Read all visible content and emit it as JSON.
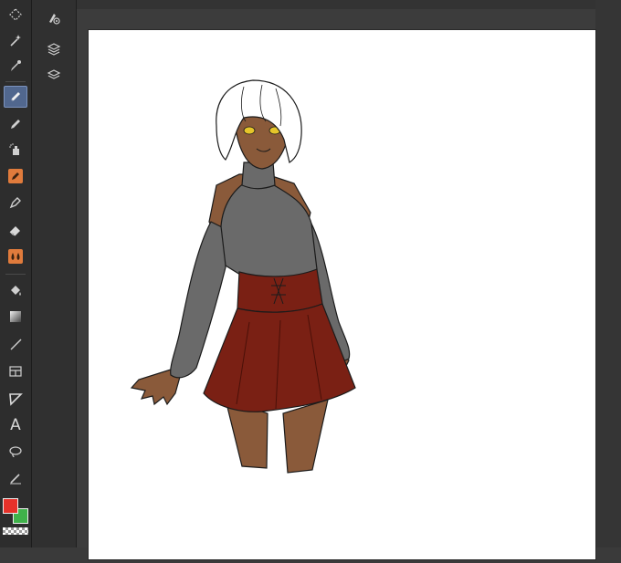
{
  "toolbar": {
    "tools": [
      {
        "name": "marquee-select-tool",
        "icon": "dotted-select-icon",
        "active": false
      },
      {
        "name": "magic-wand-tool",
        "icon": "magic-wand-icon",
        "active": false
      },
      {
        "name": "eyedropper-tool",
        "icon": "eyedropper-icon",
        "active": false
      },
      {
        "name": "pen-tool",
        "icon": "pen-icon",
        "active": true
      },
      {
        "name": "pencil-tool",
        "icon": "pencil-icon",
        "active": false
      },
      {
        "name": "airbrush-tool",
        "icon": "airbrush-icon",
        "active": false
      },
      {
        "name": "decoration-tool",
        "icon": "decoration-icon",
        "active": false
      },
      {
        "name": "ink-pen-tool",
        "icon": "ink-pen-icon",
        "active": false
      },
      {
        "name": "eraser-tool",
        "icon": "eraser-icon",
        "active": false
      },
      {
        "name": "blend-tool",
        "icon": "blend-drops-icon",
        "active": false
      },
      {
        "name": "fill-tool",
        "icon": "fill-bucket-icon",
        "active": false
      },
      {
        "name": "gradient-tool",
        "icon": "gradient-icon",
        "active": false
      },
      {
        "name": "line-tool",
        "icon": "line-icon",
        "active": false
      },
      {
        "name": "frame-tool",
        "icon": "frame-icon",
        "active": false
      },
      {
        "name": "ruler-tool",
        "icon": "ruler-icon",
        "active": false
      },
      {
        "name": "text-tool",
        "icon": "text-icon",
        "label": "A",
        "active": false
      },
      {
        "name": "lasso-tool",
        "icon": "lasso-icon",
        "active": false
      },
      {
        "name": "correct-line-tool",
        "icon": "correct-line-icon",
        "active": false
      }
    ],
    "foreground_color": "#e6312a",
    "background_color": "#3fb24a"
  },
  "sub_tools": [
    {
      "name": "sub-tool-brush",
      "icon": "brush-settings-icon"
    },
    {
      "name": "sub-tool-layers-stack",
      "icon": "layers-stack-icon"
    },
    {
      "name": "sub-tool-layers",
      "icon": "layers-icon"
    }
  ],
  "canvas": {
    "background": "#ffffff",
    "content": "character-illustration"
  },
  "colors": {
    "skin": "#8a5a3a",
    "sweater": "#6a6a6a",
    "skirt": "#7a2014",
    "hair": "#ffffff",
    "eyes": "#e6c52a"
  }
}
